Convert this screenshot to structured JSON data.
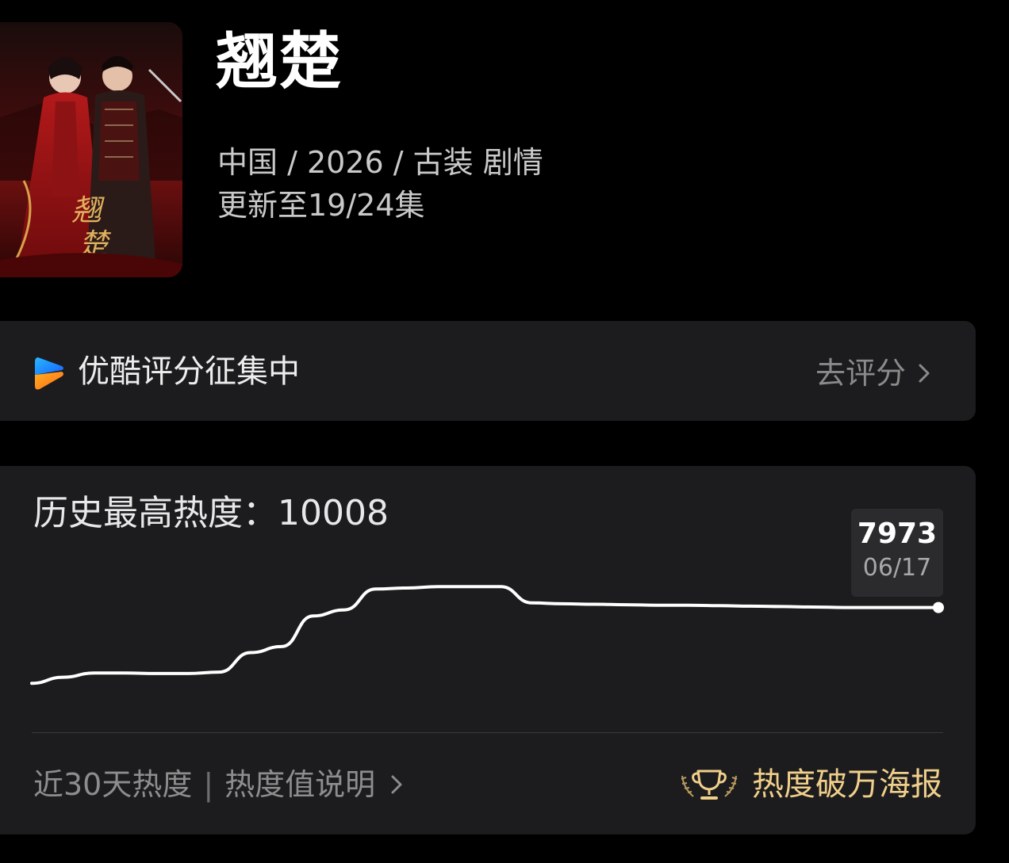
{
  "show": {
    "title": "翘楚",
    "meta_line": "中国 / 2026 / 古装 剧情",
    "episodes": "更新至19/24集"
  },
  "rating": {
    "label": "优酷评分征集中",
    "action": "去评分"
  },
  "heat": {
    "peak_text": "历史最高热度：10008",
    "tooltip_value": "7973",
    "tooltip_date": "06/17",
    "footer_range": "近30天热度",
    "footer_separator": "|",
    "footer_explain": "热度值说明",
    "footer_poster": "热度破万海报",
    "accent_color": "#f0cf8a"
  },
  "chart_data": {
    "type": "line",
    "values": [
      5470,
      5600,
      5690,
      5690,
      5680,
      5680,
      5710,
      6130,
      6260,
      6920,
      7050,
      7500,
      7520,
      7550,
      7550,
      7550,
      7200,
      7180,
      7170,
      7160,
      7150,
      7150,
      7140,
      7130,
      7120,
      7110,
      7100,
      7100,
      7100,
      7100
    ],
    "highlight": {
      "label": "06/17",
      "value": 7973
    },
    "grid": false
  }
}
